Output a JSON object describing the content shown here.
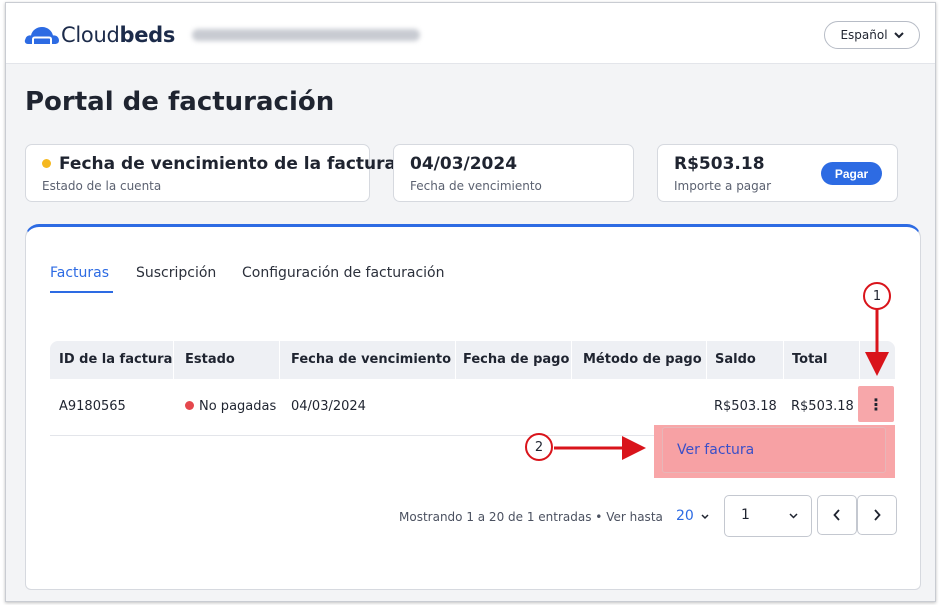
{
  "header": {
    "brand_prefix": "Cloud",
    "brand_suffix": "beds",
    "language": "Español"
  },
  "page_title": "Portal de facturación",
  "summary": {
    "account_status": {
      "value": "Fecha de vencimiento de la factura",
      "label": "Estado de la cuenta",
      "dot_color": "#f5b81f"
    },
    "due_date": {
      "value": "04/03/2024",
      "label": "Fecha de vencimiento"
    },
    "amount_due": {
      "value": "R$503.18",
      "label": "Importe a pagar",
      "pay_label": "Pagar"
    }
  },
  "tabs": [
    {
      "label": "Facturas",
      "active": true
    },
    {
      "label": "Suscripción",
      "active": false
    },
    {
      "label": "Configuración de facturación",
      "active": false
    }
  ],
  "table": {
    "columns": [
      "ID de la factura",
      "Estado",
      "Fecha de vencimiento",
      "Fecha de pago",
      "Método de pago",
      "Saldo",
      "Total"
    ],
    "rows": [
      {
        "id": "A9180565",
        "status": "No pagadas",
        "status_color": "#e5484d",
        "due_date": "04/03/2024",
        "payment_date": "",
        "payment_method": "",
        "balance": "R$503.18",
        "total": "R$503.18",
        "actions_icon": "⋮"
      }
    ]
  },
  "row_menu": {
    "view_invoice": "Ver factura"
  },
  "pagination": {
    "summary": "Mostrando 1 a 20 de 1 entradas • Ver hasta",
    "per_page": "20",
    "page": "1"
  },
  "annotations": {
    "step1": "1",
    "step2": "2",
    "color": "#d9141b"
  },
  "colors": {
    "accent": "#2d6be3",
    "highlight": "#f7a1a4"
  }
}
